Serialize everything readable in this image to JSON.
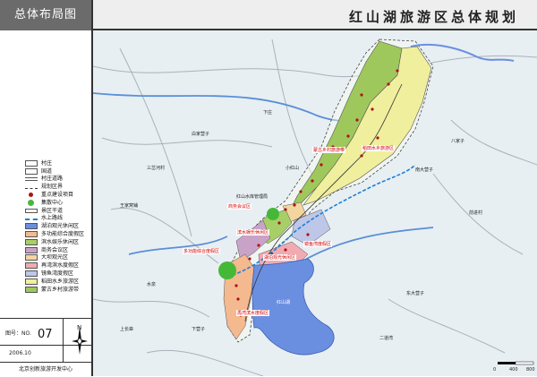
{
  "title": "红山湖旅游区总体规划",
  "side_title": "总体布局图",
  "legend": [
    {
      "label": "村庄",
      "icon": "village-icon",
      "color": "#ffffff"
    },
    {
      "label": "国道",
      "icon": "national-road-icon",
      "color": "#ffffff"
    },
    {
      "label": "村庄道路",
      "icon": "village-road-icon",
      "color": "#ffffff"
    },
    {
      "label": "规划区界",
      "icon": "planning-boundary-icon",
      "color": "#ffffff"
    },
    {
      "label": "重点建设项目",
      "icon": "key-project-icon",
      "color": "#b0101a"
    },
    {
      "label": "集散中心",
      "icon": "distribution-center-icon",
      "color": "#46b838"
    },
    {
      "label": "景区干道",
      "icon": "scenic-road-icon",
      "color": "#ffffff"
    },
    {
      "label": "水上路线",
      "icon": "water-route-icon",
      "color": "#1e7fd6"
    },
    {
      "label": "湖泊观光休闲区",
      "icon": "lake-area-icon",
      "color": "#6b8fe0"
    },
    {
      "label": "多功能综合度假区",
      "icon": "resort-area-icon",
      "color": "#f4b98f"
    },
    {
      "label": "滨水娱乐休闲区",
      "icon": "waterfront-area-icon",
      "color": "#a7cf67"
    },
    {
      "label": "商务会议区",
      "icon": "business-area-icon",
      "color": "#c9a3c7"
    },
    {
      "label": "大坝观光区",
      "icon": "dam-area-icon",
      "color": "#f3d5a0"
    },
    {
      "label": "再湾滨水度假区",
      "icon": "bay-resort-area-icon",
      "color": "#f2aab2"
    },
    {
      "label": "镜鱼湾度假区",
      "icon": "fish-bay-area-icon",
      "color": "#bfc7e8"
    },
    {
      "label": "稻田水乡旅游区",
      "icon": "paddy-area-icon",
      "color": "#f0ef9d"
    },
    {
      "label": "蒙古乡村旅游带",
      "icon": "mongol-belt-icon",
      "color": "#9fc85c"
    }
  ],
  "info": {
    "drawing_no_label": "图号：NO.",
    "drawing_no": "07",
    "date": "2006.10",
    "north": "N",
    "company": "北京创新旅游开发中心",
    "scale_labels": [
      "0",
      "400",
      "800"
    ]
  },
  "map_labels": {
    "red": [
      "蒙古乡村旅游带",
      "稻田水乡旅游区",
      "商务会议区",
      "滨水娱乐休闲区",
      "多功能综合度假区",
      "湖泊观光休闲区",
      "镜鱼湾度假区",
      "再湾滨水度假区"
    ],
    "place": [
      "下庄",
      "白家营子",
      "三岔河村",
      "王家窝铺",
      "南大营子",
      "八家子",
      "水泉",
      "上长皋",
      "小红山",
      "红山水库管理局",
      "下营子",
      "东大营子",
      "前进村",
      "红山湖",
      "二道湾"
    ]
  }
}
